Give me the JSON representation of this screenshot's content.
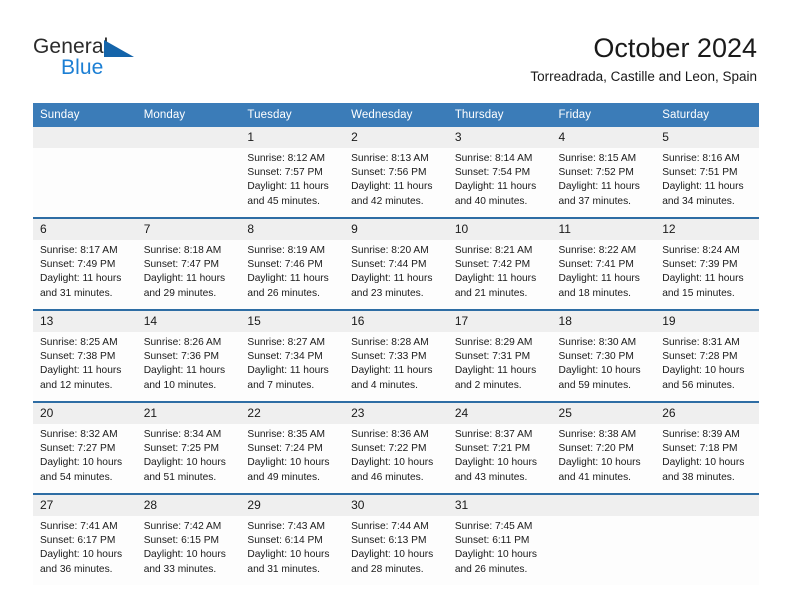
{
  "brand": {
    "name_top": "General",
    "name_bottom": "Blue",
    "accent_color": "#1c7fd4",
    "triangle_color": "#1464aa"
  },
  "header": {
    "title": "October 2024",
    "subtitle": "Torreadrada, Castille and Leon, Spain"
  },
  "theme": {
    "header_bg": "#3b7cb8",
    "row_separator": "#2e6da4",
    "daynum_bg": "#efefef",
    "cell_bg": "#fdfdfd"
  },
  "weekday_headers": [
    "Sunday",
    "Monday",
    "Tuesday",
    "Wednesday",
    "Thursday",
    "Friday",
    "Saturday"
  ],
  "weeks": [
    [
      {
        "day": "",
        "sunrise": "",
        "sunset": "",
        "daylight_line1": "",
        "daylight_line2": "",
        "empty": true
      },
      {
        "day": "",
        "sunrise": "",
        "sunset": "",
        "daylight_line1": "",
        "daylight_line2": "",
        "empty": true
      },
      {
        "day": "1",
        "sunrise": "Sunrise: 8:12 AM",
        "sunset": "Sunset: 7:57 PM",
        "daylight_line1": "Daylight: 11 hours",
        "daylight_line2": "and 45 minutes."
      },
      {
        "day": "2",
        "sunrise": "Sunrise: 8:13 AM",
        "sunset": "Sunset: 7:56 PM",
        "daylight_line1": "Daylight: 11 hours",
        "daylight_line2": "and 42 minutes."
      },
      {
        "day": "3",
        "sunrise": "Sunrise: 8:14 AM",
        "sunset": "Sunset: 7:54 PM",
        "daylight_line1": "Daylight: 11 hours",
        "daylight_line2": "and 40 minutes."
      },
      {
        "day": "4",
        "sunrise": "Sunrise: 8:15 AM",
        "sunset": "Sunset: 7:52 PM",
        "daylight_line1": "Daylight: 11 hours",
        "daylight_line2": "and 37 minutes."
      },
      {
        "day": "5",
        "sunrise": "Sunrise: 8:16 AM",
        "sunset": "Sunset: 7:51 PM",
        "daylight_line1": "Daylight: 11 hours",
        "daylight_line2": "and 34 minutes."
      }
    ],
    [
      {
        "day": "6",
        "sunrise": "Sunrise: 8:17 AM",
        "sunset": "Sunset: 7:49 PM",
        "daylight_line1": "Daylight: 11 hours",
        "daylight_line2": "and 31 minutes."
      },
      {
        "day": "7",
        "sunrise": "Sunrise: 8:18 AM",
        "sunset": "Sunset: 7:47 PM",
        "daylight_line1": "Daylight: 11 hours",
        "daylight_line2": "and 29 minutes."
      },
      {
        "day": "8",
        "sunrise": "Sunrise: 8:19 AM",
        "sunset": "Sunset: 7:46 PM",
        "daylight_line1": "Daylight: 11 hours",
        "daylight_line2": "and 26 minutes."
      },
      {
        "day": "9",
        "sunrise": "Sunrise: 8:20 AM",
        "sunset": "Sunset: 7:44 PM",
        "daylight_line1": "Daylight: 11 hours",
        "daylight_line2": "and 23 minutes."
      },
      {
        "day": "10",
        "sunrise": "Sunrise: 8:21 AM",
        "sunset": "Sunset: 7:42 PM",
        "daylight_line1": "Daylight: 11 hours",
        "daylight_line2": "and 21 minutes."
      },
      {
        "day": "11",
        "sunrise": "Sunrise: 8:22 AM",
        "sunset": "Sunset: 7:41 PM",
        "daylight_line1": "Daylight: 11 hours",
        "daylight_line2": "and 18 minutes."
      },
      {
        "day": "12",
        "sunrise": "Sunrise: 8:24 AM",
        "sunset": "Sunset: 7:39 PM",
        "daylight_line1": "Daylight: 11 hours",
        "daylight_line2": "and 15 minutes."
      }
    ],
    [
      {
        "day": "13",
        "sunrise": "Sunrise: 8:25 AM",
        "sunset": "Sunset: 7:38 PM",
        "daylight_line1": "Daylight: 11 hours",
        "daylight_line2": "and 12 minutes."
      },
      {
        "day": "14",
        "sunrise": "Sunrise: 8:26 AM",
        "sunset": "Sunset: 7:36 PM",
        "daylight_line1": "Daylight: 11 hours",
        "daylight_line2": "and 10 minutes."
      },
      {
        "day": "15",
        "sunrise": "Sunrise: 8:27 AM",
        "sunset": "Sunset: 7:34 PM",
        "daylight_line1": "Daylight: 11 hours",
        "daylight_line2": "and 7 minutes."
      },
      {
        "day": "16",
        "sunrise": "Sunrise: 8:28 AM",
        "sunset": "Sunset: 7:33 PM",
        "daylight_line1": "Daylight: 11 hours",
        "daylight_line2": "and 4 minutes."
      },
      {
        "day": "17",
        "sunrise": "Sunrise: 8:29 AM",
        "sunset": "Sunset: 7:31 PM",
        "daylight_line1": "Daylight: 11 hours",
        "daylight_line2": "and 2 minutes."
      },
      {
        "day": "18",
        "sunrise": "Sunrise: 8:30 AM",
        "sunset": "Sunset: 7:30 PM",
        "daylight_line1": "Daylight: 10 hours",
        "daylight_line2": "and 59 minutes."
      },
      {
        "day": "19",
        "sunrise": "Sunrise: 8:31 AM",
        "sunset": "Sunset: 7:28 PM",
        "daylight_line1": "Daylight: 10 hours",
        "daylight_line2": "and 56 minutes."
      }
    ],
    [
      {
        "day": "20",
        "sunrise": "Sunrise: 8:32 AM",
        "sunset": "Sunset: 7:27 PM",
        "daylight_line1": "Daylight: 10 hours",
        "daylight_line2": "and 54 minutes."
      },
      {
        "day": "21",
        "sunrise": "Sunrise: 8:34 AM",
        "sunset": "Sunset: 7:25 PM",
        "daylight_line1": "Daylight: 10 hours",
        "daylight_line2": "and 51 minutes."
      },
      {
        "day": "22",
        "sunrise": "Sunrise: 8:35 AM",
        "sunset": "Sunset: 7:24 PM",
        "daylight_line1": "Daylight: 10 hours",
        "daylight_line2": "and 49 minutes."
      },
      {
        "day": "23",
        "sunrise": "Sunrise: 8:36 AM",
        "sunset": "Sunset: 7:22 PM",
        "daylight_line1": "Daylight: 10 hours",
        "daylight_line2": "and 46 minutes."
      },
      {
        "day": "24",
        "sunrise": "Sunrise: 8:37 AM",
        "sunset": "Sunset: 7:21 PM",
        "daylight_line1": "Daylight: 10 hours",
        "daylight_line2": "and 43 minutes."
      },
      {
        "day": "25",
        "sunrise": "Sunrise: 8:38 AM",
        "sunset": "Sunset: 7:20 PM",
        "daylight_line1": "Daylight: 10 hours",
        "daylight_line2": "and 41 minutes."
      },
      {
        "day": "26",
        "sunrise": "Sunrise: 8:39 AM",
        "sunset": "Sunset: 7:18 PM",
        "daylight_line1": "Daylight: 10 hours",
        "daylight_line2": "and 38 minutes."
      }
    ],
    [
      {
        "day": "27",
        "sunrise": "Sunrise: 7:41 AM",
        "sunset": "Sunset: 6:17 PM",
        "daylight_line1": "Daylight: 10 hours",
        "daylight_line2": "and 36 minutes."
      },
      {
        "day": "28",
        "sunrise": "Sunrise: 7:42 AM",
        "sunset": "Sunset: 6:15 PM",
        "daylight_line1": "Daylight: 10 hours",
        "daylight_line2": "and 33 minutes."
      },
      {
        "day": "29",
        "sunrise": "Sunrise: 7:43 AM",
        "sunset": "Sunset: 6:14 PM",
        "daylight_line1": "Daylight: 10 hours",
        "daylight_line2": "and 31 minutes."
      },
      {
        "day": "30",
        "sunrise": "Sunrise: 7:44 AM",
        "sunset": "Sunset: 6:13 PM",
        "daylight_line1": "Daylight: 10 hours",
        "daylight_line2": "and 28 minutes."
      },
      {
        "day": "31",
        "sunrise": "Sunrise: 7:45 AM",
        "sunset": "Sunset: 6:11 PM",
        "daylight_line1": "Daylight: 10 hours",
        "daylight_line2": "and 26 minutes."
      },
      {
        "day": "",
        "sunrise": "",
        "sunset": "",
        "daylight_line1": "",
        "daylight_line2": "",
        "empty": true
      },
      {
        "day": "",
        "sunrise": "",
        "sunset": "",
        "daylight_line1": "",
        "daylight_line2": "",
        "empty": true
      }
    ]
  ]
}
